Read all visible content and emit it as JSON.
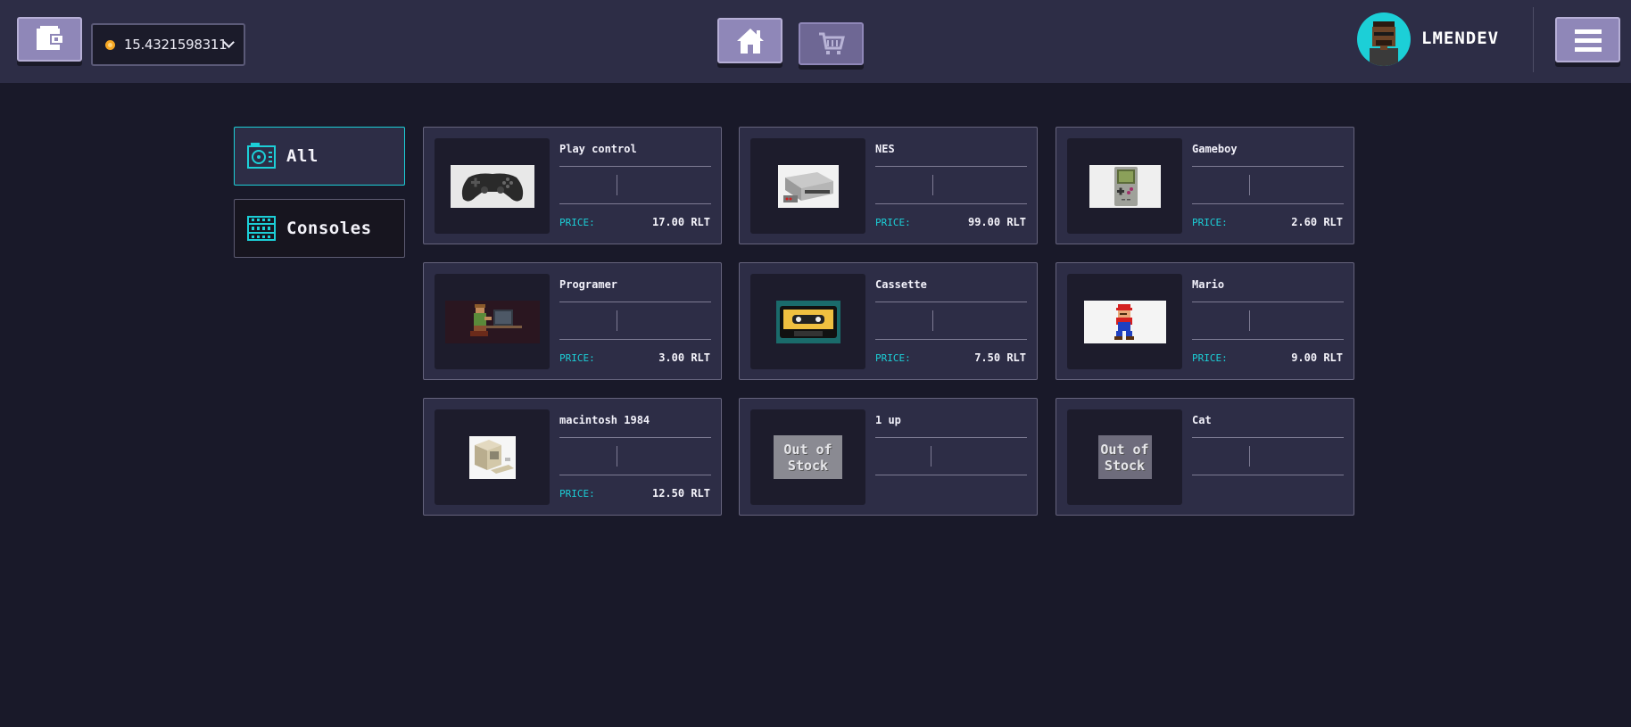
{
  "header": {
    "balance": "15.4321598311",
    "username": "LMENDEV",
    "icons": {
      "wallet": "wallet-icon",
      "home": "home-icon",
      "cart": "cart-icon",
      "menu": "hamburger-menu-icon",
      "coin": "coin-icon",
      "dropdown": "chevron-down-icon"
    }
  },
  "categories": [
    {
      "label": "All",
      "icon": "chip-icon",
      "active": true
    },
    {
      "label": "Consoles",
      "icon": "console-icon",
      "active": false
    }
  ],
  "products": [
    {
      "name": "Play control",
      "price_label": "PRICE:",
      "price": "17.00 RLT",
      "image": "gamepad",
      "in_stock": true
    },
    {
      "name": "NES",
      "price_label": "PRICE:",
      "price": "99.00 RLT",
      "image": "nes-console",
      "in_stock": true
    },
    {
      "name": "Gameboy",
      "price_label": "PRICE:",
      "price": "2.60 RLT",
      "image": "gameboy",
      "in_stock": true
    },
    {
      "name": "Programer",
      "price_label": "PRICE:",
      "price": "3.00 RLT",
      "image": "programmer",
      "in_stock": true
    },
    {
      "name": "Cassette",
      "price_label": "PRICE:",
      "price": "7.50 RLT",
      "image": "cassette",
      "in_stock": true
    },
    {
      "name": "Mario",
      "price_label": "PRICE:",
      "price": "9.00 RLT",
      "image": "mario",
      "in_stock": true
    },
    {
      "name": "macintosh 1984",
      "price_label": "PRICE:",
      "price": "12.50 RLT",
      "image": "macintosh",
      "in_stock": true
    },
    {
      "name": "1 up",
      "image": "one-up-mushroom",
      "in_stock": false,
      "stock_text_1": "Out of",
      "stock_text_2": "Stock"
    },
    {
      "name": "Cat",
      "image": "cat",
      "in_stock": false,
      "stock_text_1": "Out of",
      "stock_text_2": "Stock"
    }
  ],
  "colors": {
    "background": "#191929",
    "header": "#2d2d46",
    "accent": "#1ccfd7",
    "button": "#8f87b8"
  }
}
